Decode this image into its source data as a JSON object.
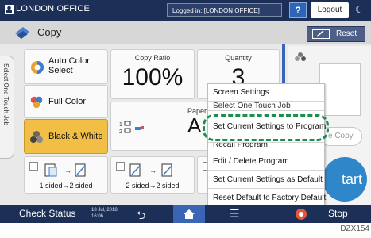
{
  "topbar": {
    "title": "LONDON OFFICE",
    "login_status": "Logged in: [LONDON OFFICE]",
    "help_label": "?",
    "logout_label": "Logout"
  },
  "app": {
    "title": "Copy",
    "reset_label": "Reset"
  },
  "side_tab": {
    "label": "Select One Touch Job"
  },
  "color_modes": [
    {
      "label_line1": "Auto Color",
      "label_line2": "Select"
    },
    {
      "label": "Full Color"
    },
    {
      "label": "Black & White",
      "selected": true
    }
  ],
  "copy_ratio": {
    "title": "Copy Ratio",
    "value": "100%"
  },
  "quantity": {
    "title": "Quantity",
    "value": "3"
  },
  "paper": {
    "title_visible": "Paper",
    "value_visible": "A"
  },
  "duplex": [
    {
      "label": "1 sided→2 sided"
    },
    {
      "label": "2 sided→2 sided"
    }
  ],
  "right_panel": {
    "copy_label": "e Copy",
    "start_label": "tart"
  },
  "menu": {
    "partial_item": "Select One Touch Job",
    "items": [
      "Screen Settings",
      "Set Current Settings to Program",
      "Recall Program",
      "Edit / Delete Program",
      "Set Current Settings as Default",
      "Reset Default to Factory Default"
    ],
    "highlighted_index": 1
  },
  "statusbar": {
    "check_status": "Check Status",
    "date": "18 Jul, 2018",
    "time": "16:06",
    "stop_label": "Stop"
  },
  "figure_code": "DZX154",
  "colors": {
    "topbar": "#1c2f56",
    "accent_blue": "#3a64b6",
    "selected_yellow": "#f1bf45",
    "callout_green": "#1c8e4f",
    "start_blue": "#2f86c9"
  }
}
